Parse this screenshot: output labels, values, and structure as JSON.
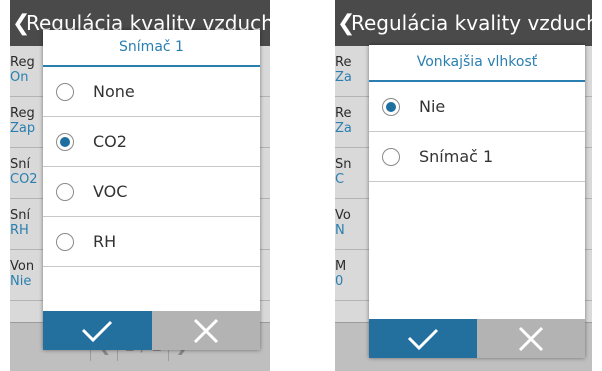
{
  "left": {
    "header_title": "Regulácia kvality vzduchu",
    "back_icon": "chevron-left-icon",
    "bg_rows": [
      {
        "label": "Reg",
        "value": "On"
      },
      {
        "label": "Reg",
        "value": "Zap"
      },
      {
        "label": "Sní",
        "value": "CO2"
      },
      {
        "label": "Sní",
        "value": "RH"
      },
      {
        "label": "Von",
        "value": "Nie"
      }
    ],
    "pager": {
      "prev": "❮",
      "text": "1 / 2",
      "next": "❯"
    },
    "dialog": {
      "title": "Snímač 1",
      "options": [
        {
          "label": "None",
          "selected": false
        },
        {
          "label": "CO2",
          "selected": true
        },
        {
          "label": "VOC",
          "selected": false
        },
        {
          "label": "RH",
          "selected": false
        }
      ],
      "ok_icon": "checkmark-icon",
      "cancel_icon": "close-icon"
    }
  },
  "right": {
    "header_title": "Regulácia kvality vzduchu",
    "back_icon": "chevron-left-icon",
    "bg_rows": [
      {
        "label": "Re",
        "value": "Za"
      },
      {
        "label": "Re",
        "value": "Za"
      },
      {
        "label": "Sn",
        "value": "C"
      },
      {
        "label": "Vo",
        "value": "N"
      },
      {
        "label": "M",
        "value": "0"
      }
    ],
    "dialog": {
      "title": "Vonkajšia vlhkosť",
      "options": [
        {
          "label": "Nie",
          "selected": true
        },
        {
          "label": "Snímač 1",
          "selected": false
        }
      ],
      "ok_icon": "checkmark-icon",
      "cancel_icon": "close-icon"
    }
  },
  "colors": {
    "accent": "#2a7fb0",
    "ok_button": "#236f9d",
    "cancel_button": "#b3b3b3",
    "header": "#4a4a4a"
  }
}
